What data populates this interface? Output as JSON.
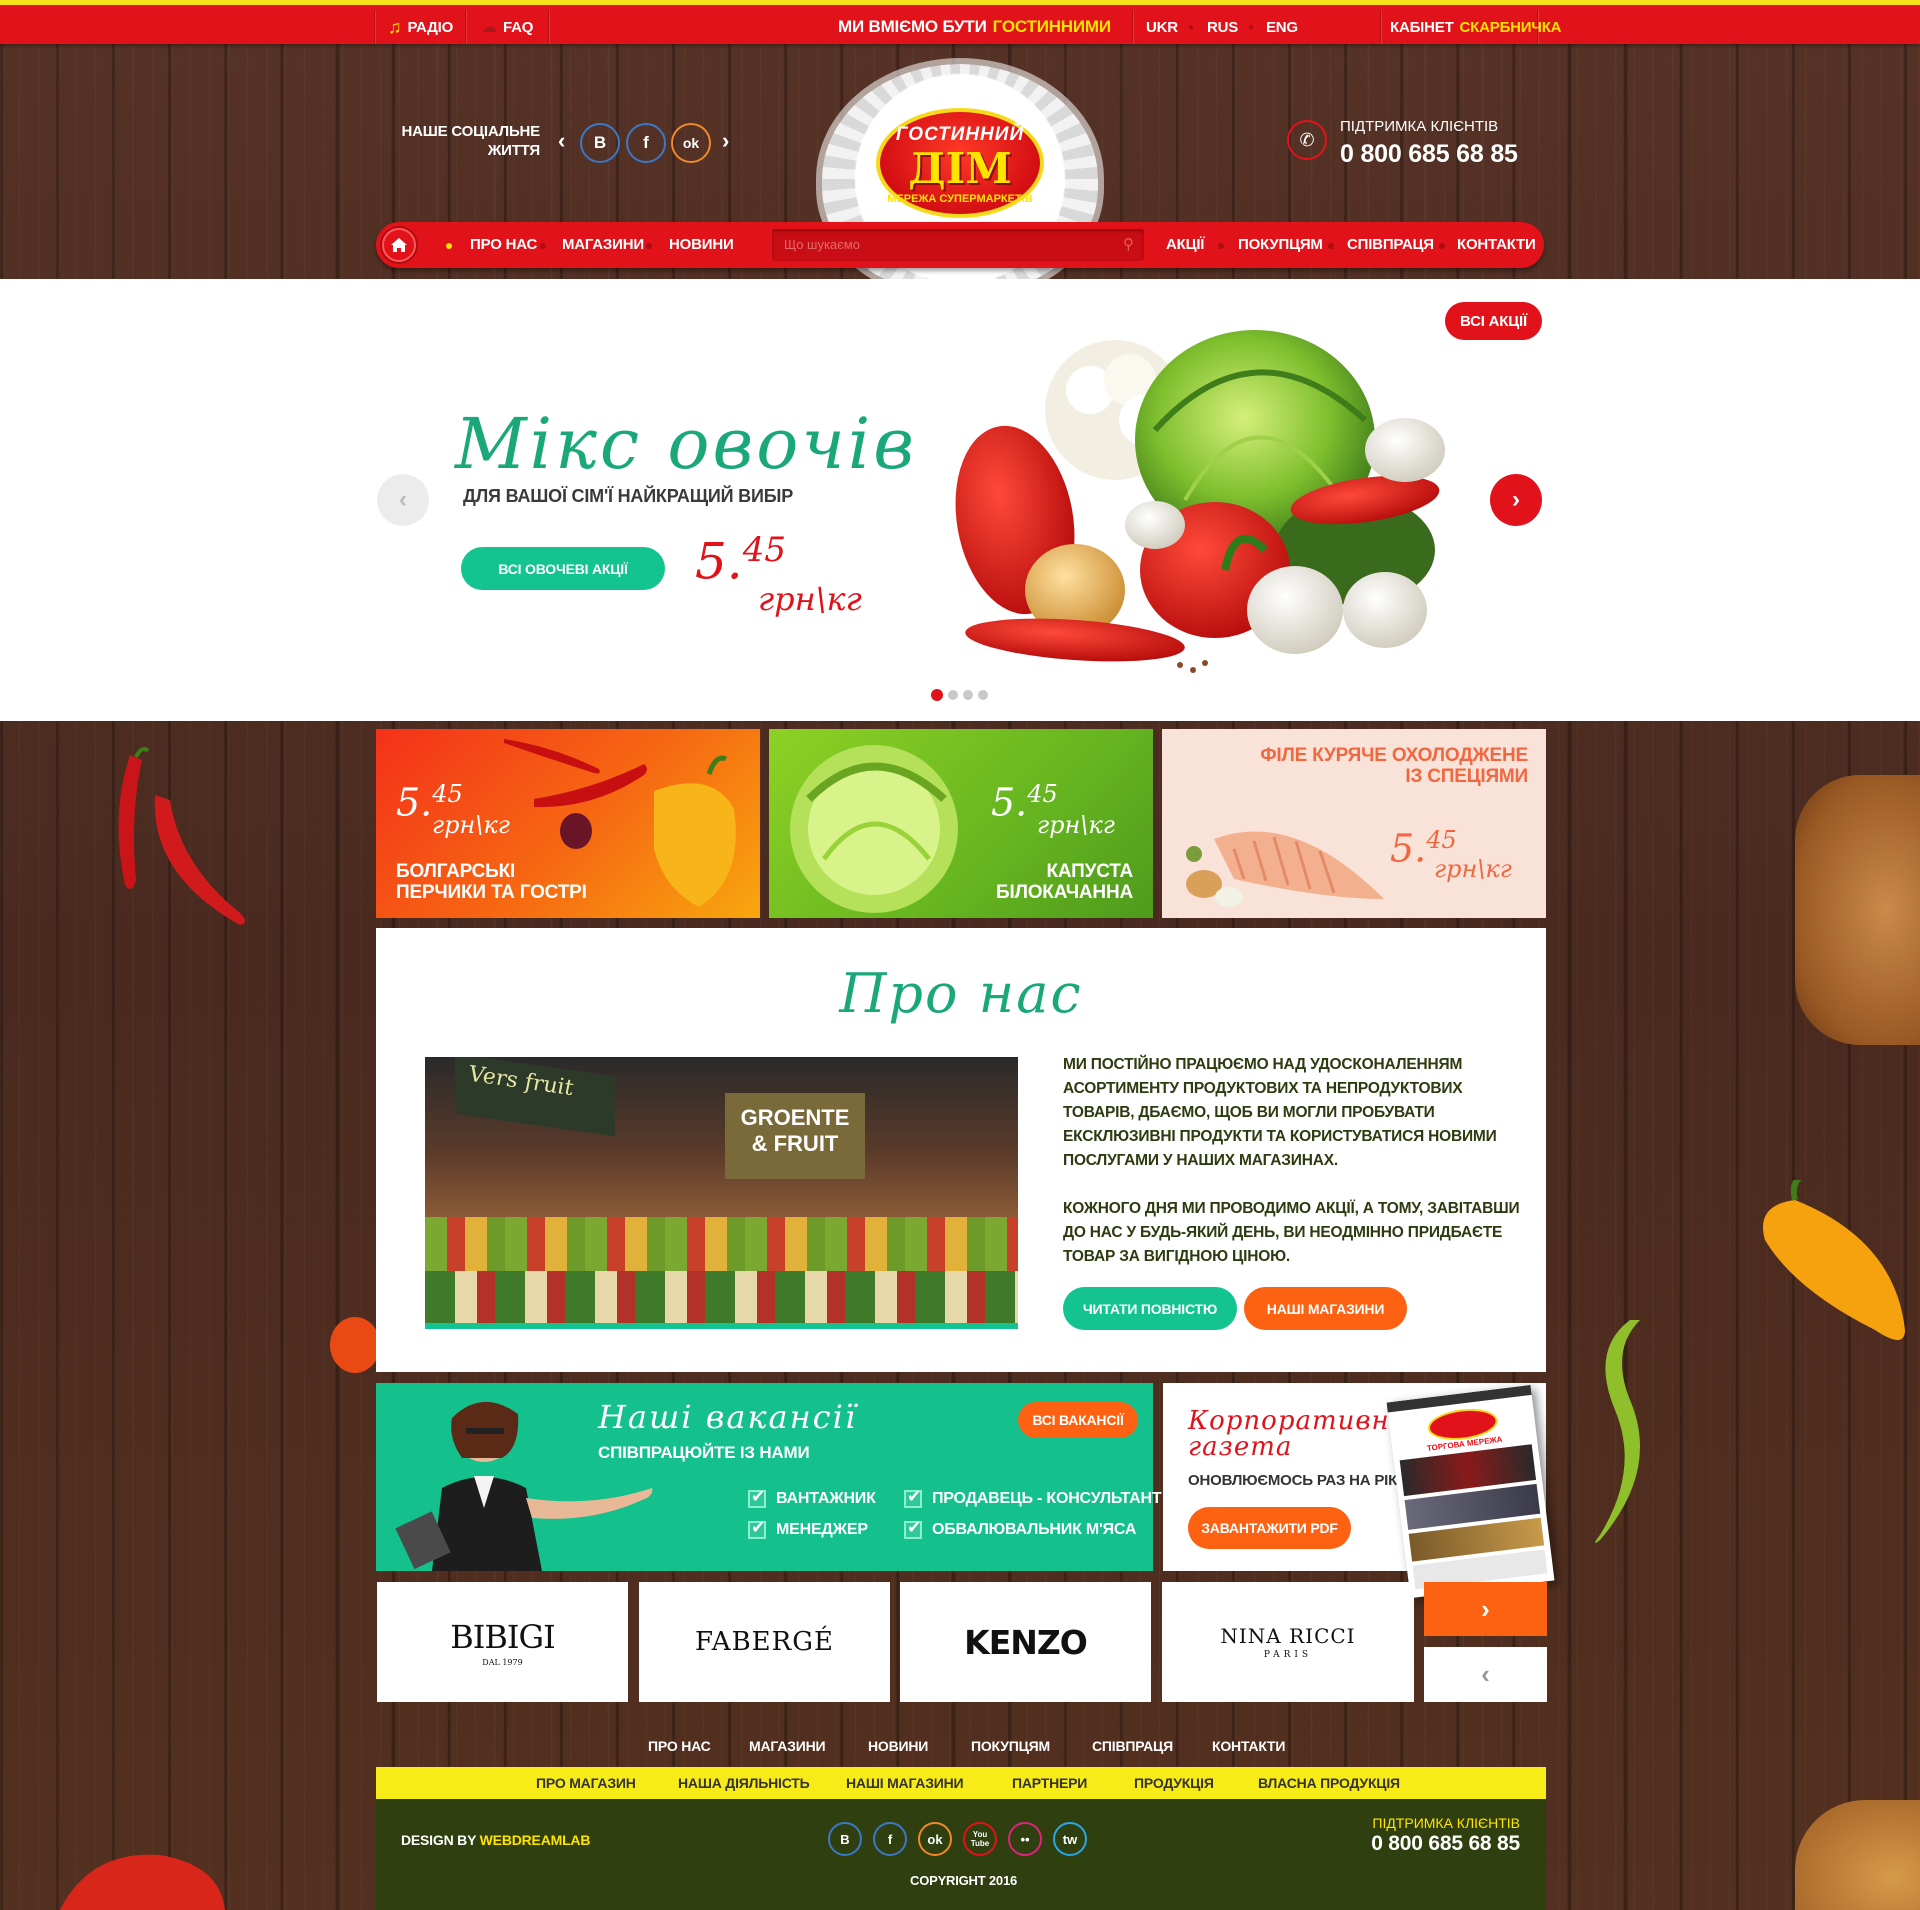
{
  "topbar": {
    "radio": "РАДІО",
    "faq": "FAQ",
    "slogan_a": "МИ ВМІЄМО БУТИ",
    "slogan_b": "ГОСТИННИМИ",
    "langs": [
      "UKR",
      "RUS",
      "ENG"
    ],
    "cabinet_a": "КАБІНЕТ",
    "cabinet_b": "СКАРБНИЧКА"
  },
  "header": {
    "social_label_line1": "НАШЕ СОЦІАЛЬНЕ",
    "social_label_line2": "ЖИТТЯ",
    "social": [
      "В",
      "f",
      "ok"
    ],
    "support_label": "ПІДТРИМКА КЛІЄНТІВ",
    "phone": "0 800 685 68 85"
  },
  "logo": {
    "ribbon": "ГОСТИННИЙ",
    "name": "ДІМ",
    "subtitle": "МЕРЕЖА СУПЕРМАРКЕТІВ"
  },
  "nav": {
    "left": [
      "ПРО НАС",
      "МАГАЗИНИ",
      "НОВИНИ"
    ],
    "right": [
      "АКЦІЇ",
      "ПОКУПЦЯМ",
      "СПІВПРАЦЯ",
      "КОНТАКТИ"
    ],
    "search_placeholder": "Що шукаємо"
  },
  "hero": {
    "all_promos": "ВСІ АКЦІЇ",
    "title": "Мікс овочів",
    "subtitle": "ДЛЯ ВАШОЇ СІМ'Ї НАЙКРАЩИЙ ВИБІР",
    "cta": "ВСІ ОВОЧЕВІ АКЦІЇ",
    "price_int": "5.",
    "price_dec": "45",
    "unit": "грн\\кг",
    "slide_total": 4,
    "slide_active": 1
  },
  "tiles": [
    {
      "price_int": "5.",
      "price_dec": "45",
      "unit": "грн\\кг",
      "line1": "БОЛГАРСЬКІ",
      "line2": "ПЕРЧИКИ ТА ГОСТРІ"
    },
    {
      "price_int": "5.",
      "price_dec": "45",
      "unit": "грн\\кг",
      "line1": "КАПУСТА",
      "line2": "БІЛОКАЧАННА"
    },
    {
      "price_int": "5.",
      "price_dec": "45",
      "unit": "грн\\кг",
      "line1": "ФІЛЕ КУРЯЧЕ ОХОЛОДЖЕНЕ",
      "line2": "ІЗ СПЕЦІЯМИ"
    }
  ],
  "about": {
    "title": "Про нас",
    "p1": "МИ ПОСТІЙНО ПРАЦЮЄМО НАД УДОСКОНАЛЕННЯМ АСОРТИМЕНТУ ПРОДУКТОВИХ ТА НЕПРОДУКТОВИХ ТОВАРІВ, ДБАЄМО, ЩОБ ВИ МОГЛИ ПРОБУВАТИ ЕКСКЛЮЗИВНІ ПРОДУКТИ ТА КОРИСТУВАТИСЯ НОВИМИ ПОСЛУГАМИ У НАШИХ МАГАЗИНАХ.",
    "p2": "КОЖНОГО ДНЯ МИ ПРОВОДИМО АКЦІЇ, А ТОМУ, ЗАВІТАВШИ ДО НАС У БУДЬ-ЯКИЙ ДЕНЬ, ВИ НЕОДМІННО ПРИДБАЄТЕ ТОВАР ЗА ВИГІДНОЮ ЦІНОЮ.",
    "read_more": "ЧИТАТИ ПОВНІСТЮ",
    "our_stores": "НАШІ МАГАЗИНИ",
    "photo_sign1": "Vers fruit",
    "photo_sign2": "GROENTE",
    "photo_sign3": "& FRUIT"
  },
  "vacancies": {
    "title": "Наші вакансії",
    "subtitle": "СПІВПРАЦЮЙТЕ ІЗ НАМИ",
    "all": "ВСІ ВАКАНСІЇ",
    "jobs": [
      "ВАНТАЖНИК",
      "ПРОДАВЕЦЬ - КОНСУЛЬТАНТ",
      "МЕНЕДЖЕР",
      "ОБВАЛЮВАЛЬНИК М'ЯСА"
    ]
  },
  "corporate": {
    "title_line1": "Корпоративна",
    "title_line2": "газета",
    "subtitle": "ОНОВЛЮЄМОСЬ РАЗ НА РІК",
    "download": "ЗАВАНТАЖИТИ PDF",
    "magazine_title": "ТОРГОВА МЕРЕЖА"
  },
  "brands": {
    "items": [
      "BIBIGI",
      "FABERGÉ",
      "KENZO",
      "NINA RICCI"
    ],
    "bibigi_sub": "DAL 1979",
    "nina_sub": "PARIS"
  },
  "footer": {
    "nav": [
      "ПРО НАС",
      "МАГАЗИНИ",
      "НОВИНИ",
      "ПОКУПЦЯМ",
      "СПІВПРАЦЯ",
      "КОНТАКТИ"
    ],
    "subnav": [
      "ПРО МАГАЗИН",
      "НАША ДІЯЛЬНІСТЬ",
      "НАШІ МАГАЗИНИ",
      "ПАРТНЕРИ",
      "ПРОДУКЦІЯ",
      "ВЛАСНА ПРОДУКЦІЯ"
    ],
    "design_by": "DESIGN BY",
    "design_name": "WEBDREAMLAB",
    "social": [
      "В",
      "f",
      "ok",
      "You Tube",
      "••",
      "tw"
    ],
    "support_label": "ПІДТРИМКА КЛІЄНТІВ",
    "phone": "0 800 685 68 85",
    "copyright": "COPYRIGHT 2016"
  },
  "colors": {
    "brand_red": "#e1121a",
    "accent_yellow": "#ffe400",
    "green": "#13c390",
    "orange": "#fc6212",
    "footer_green": "#2f3f0f"
  }
}
